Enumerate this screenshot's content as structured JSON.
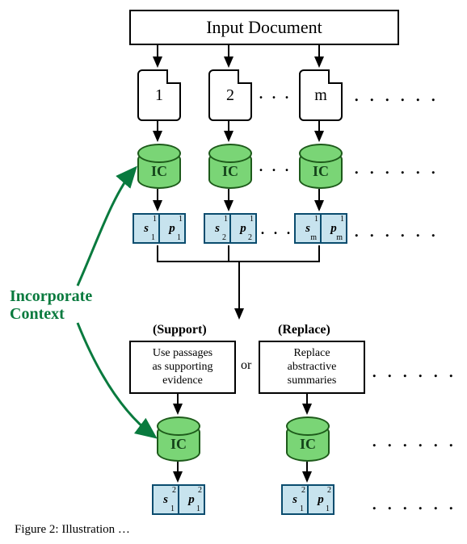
{
  "title": "Input Document",
  "pages": [
    "1",
    "2",
    "m"
  ],
  "ic_label": "IC",
  "incorporate_label": "Incorporate\nContext",
  "pairs_level1": [
    {
      "s": "s",
      "s_sub": "1",
      "s_sup": "1",
      "p": "p",
      "p_sub": "1",
      "p_sup": "1"
    },
    {
      "s": "s",
      "s_sub": "2",
      "s_sup": "1",
      "p": "p",
      "p_sub": "2",
      "p_sup": "1"
    },
    {
      "s": "s",
      "s_sub": "m",
      "s_sup": "1",
      "p": "p",
      "p_sub": "m",
      "p_sup": "1"
    }
  ],
  "support_title": "(Support)",
  "replace_title": "(Replace)",
  "support_text": "Use passages\nas supporting\nevidence",
  "replace_text": "Replace\nabstractive\nsummaries",
  "or": "or",
  "pairs_level2": [
    {
      "s": "s",
      "s_sub": "1",
      "s_sup": "2",
      "p": "p",
      "p_sub": "1",
      "p_sup": "2"
    },
    {
      "s": "s",
      "s_sub": "1",
      "s_sup": "2",
      "p": "p",
      "p_sub": "1",
      "p_sup": "2"
    }
  ],
  "ellipsis": ". . .",
  "trailing": ". . . . . .",
  "caption_prefix": "Figure 2: ",
  "caption_rest": "Illustration … "
}
